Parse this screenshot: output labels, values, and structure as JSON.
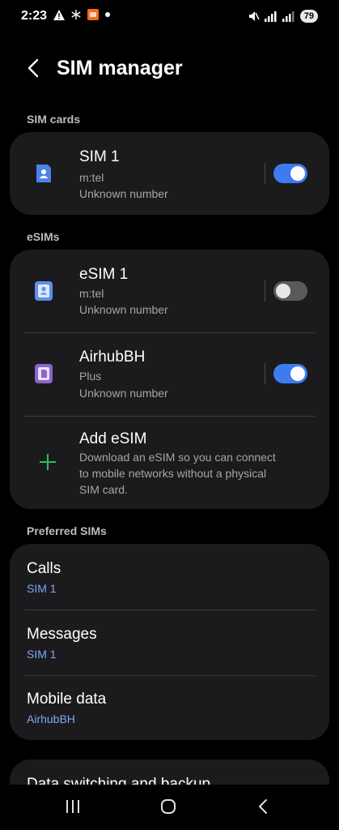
{
  "status": {
    "time": "2:23",
    "battery": "79"
  },
  "header": {
    "title": "SIM manager"
  },
  "sections": {
    "sim_cards": "SIM cards",
    "esims": "eSIMs",
    "preferred": "Preferred SIMs"
  },
  "sim1": {
    "title": "SIM 1",
    "carrier": "m:tel",
    "number": "Unknown number",
    "enabled": true
  },
  "esim1": {
    "title": "eSIM 1",
    "carrier": "m:tel",
    "number": "Unknown number",
    "enabled": false
  },
  "airhub": {
    "title": "AirhubBH",
    "carrier": "Plus",
    "number": "Unknown number",
    "enabled": true
  },
  "add_esim": {
    "title": "Add eSIM",
    "description_line1": "Download an eSIM so you can connect",
    "description_line2": "to mobile networks without a physical",
    "description_line3": "SIM card."
  },
  "preferred": {
    "calls_label": "Calls",
    "calls_value": "SIM 1",
    "messages_label": "Messages",
    "messages_value": "SIM 1",
    "data_label": "Mobile data",
    "data_value": "AirhubBH"
  },
  "more": {
    "label": "Data switching and backup"
  },
  "colors": {
    "accent": "#3e7bf0",
    "value_blue": "#7ea8f5",
    "card_bg": "#1b1b1d",
    "add_icon": "#2fbf5a"
  }
}
